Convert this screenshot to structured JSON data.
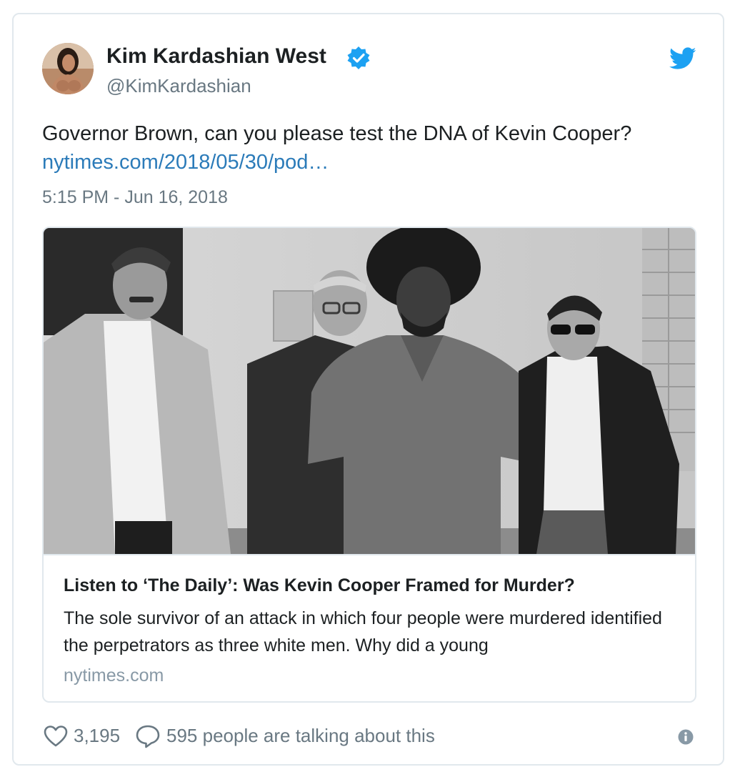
{
  "author": {
    "name": "Kim Kardashian West",
    "handle": "@KimKardashian",
    "verified_icon": "verified-badge-icon",
    "avatar_icon": "avatar"
  },
  "brand": {
    "icon": "twitter-bird-icon",
    "color": "#1da1f2"
  },
  "tweet": {
    "text": "Governor Brown, can you please test the DNA of Kevin Cooper?",
    "link": "nytimes.com/2018/05/30/pod…",
    "timestamp": "5:15 PM - Jun 16, 2018"
  },
  "card": {
    "title": "Listen to ‘The Daily’: Was Kevin Cooper Framed for Murder?",
    "description": "The sole survivor of an attack in which four people were murdered identified the perpetrators as three white men. Why did a young",
    "domain": "nytimes.com"
  },
  "footer": {
    "like_count": "3,195",
    "talking": "595 people are talking about this",
    "heart_icon": "heart-icon",
    "reply_icon": "reply-bubble-icon",
    "info_icon": "info-icon"
  },
  "colors": {
    "text": "#1c2022",
    "muted": "#697882",
    "link": "#2b7bb9",
    "border": "#e1e8ed"
  }
}
